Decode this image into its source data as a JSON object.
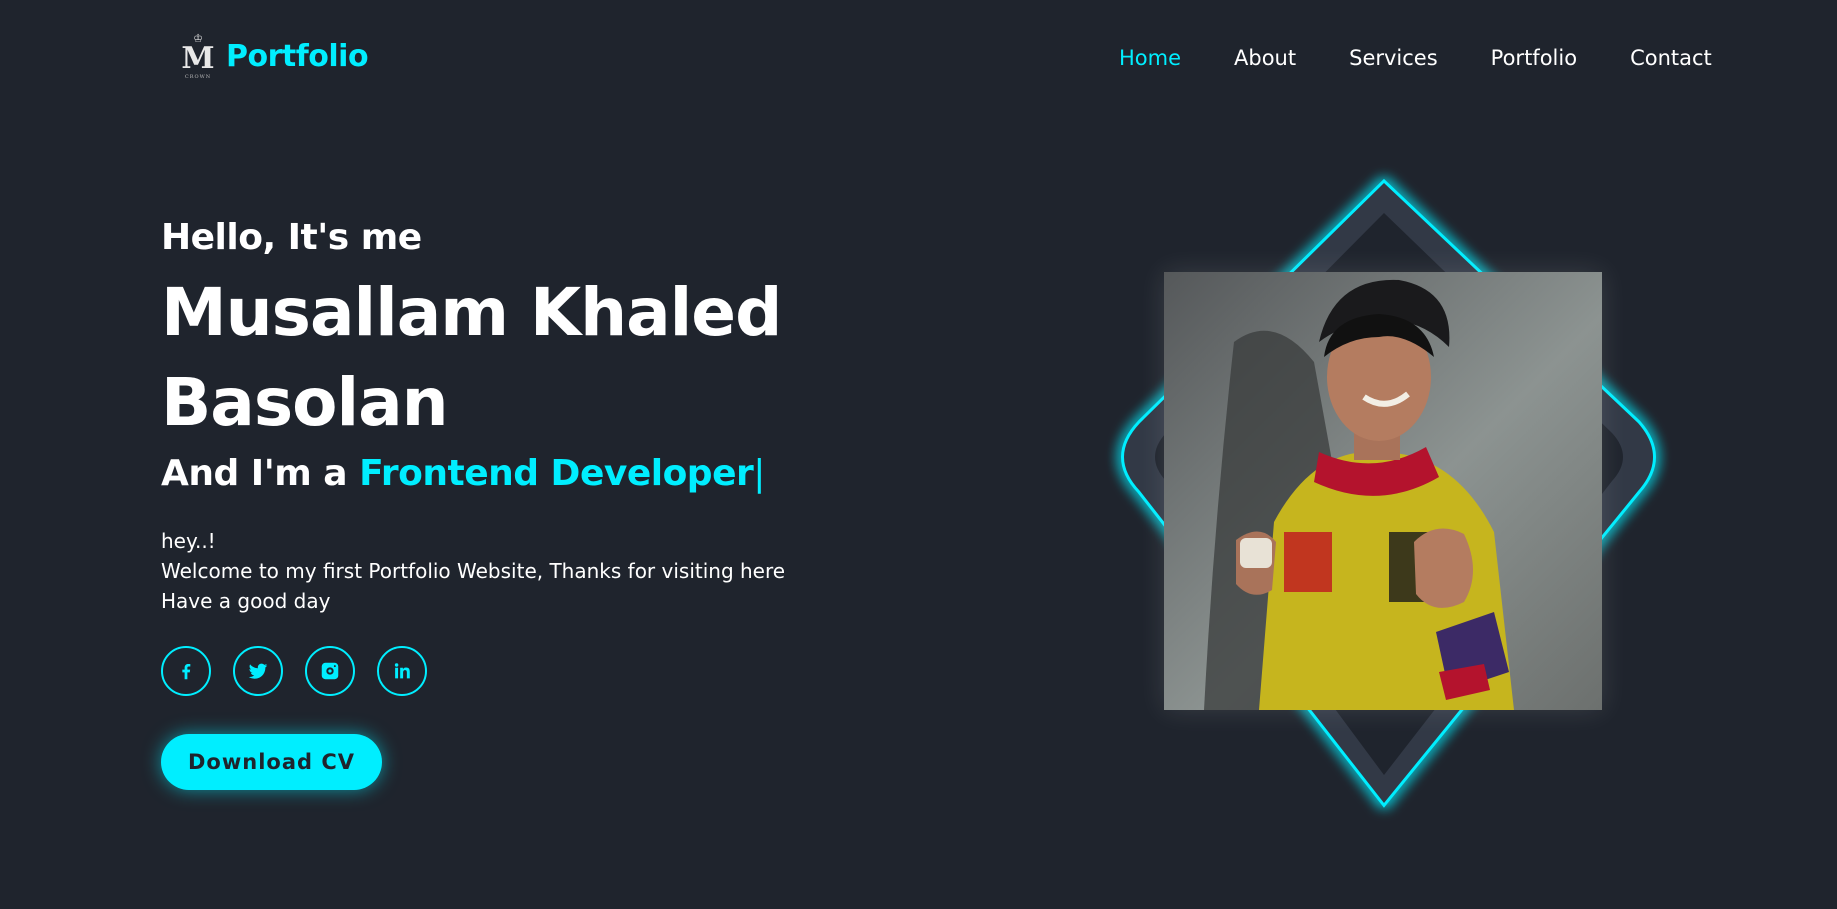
{
  "brand": {
    "logo_letter": "M",
    "logo_subtext": "CROWN",
    "title": "Portfolio"
  },
  "nav": {
    "items": [
      {
        "label": "Home",
        "active": true
      },
      {
        "label": "About",
        "active": false
      },
      {
        "label": "Services",
        "active": false
      },
      {
        "label": "Portfolio",
        "active": false
      },
      {
        "label": "Contact",
        "active": false
      }
    ]
  },
  "hero": {
    "greeting": "Hello, It's me",
    "name_line1": "Musallam Khaled",
    "name_line2": "Basolan",
    "role_prefix": "And I'm a ",
    "role_highlight": "Frontend Developer",
    "role_caret": "|",
    "intro": [
      "hey..!",
      "Welcome to my first Portfolio Website, Thanks for visiting here",
      "Have a good day"
    ],
    "socials": [
      {
        "icon": "facebook-icon"
      },
      {
        "icon": "twitter-icon"
      },
      {
        "icon": "instagram-icon"
      },
      {
        "icon": "linkedin-icon"
      }
    ],
    "cta_label": "Download CV"
  },
  "colors": {
    "background": "#1f242d",
    "accent": "#00eeff",
    "diamond": "#323946",
    "text": "#ffffff"
  },
  "image": {
    "subject": "profile-photo"
  }
}
